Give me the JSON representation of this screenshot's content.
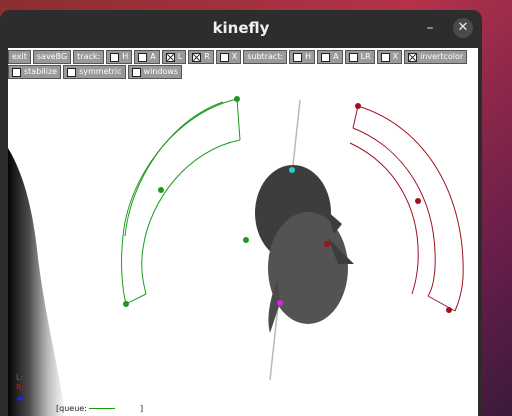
{
  "window": {
    "title": "kinefly"
  },
  "controls": {
    "minimize_glyph": "–",
    "close_glyph": "✕"
  },
  "toolbar": {
    "row1": [
      {
        "label": "exit",
        "checkbox": false
      },
      {
        "label": "saveBG",
        "checkbox": false
      },
      {
        "label": "track:",
        "checkbox": false
      },
      {
        "label": "H",
        "checkbox": true,
        "checked": false
      },
      {
        "label": "A",
        "checkbox": true,
        "checked": false
      },
      {
        "label": "L",
        "checkbox": true,
        "checked": true
      },
      {
        "label": "R",
        "checkbox": true,
        "checked": true
      },
      {
        "label": "X",
        "checkbox": true,
        "checked": false
      },
      {
        "label": "subtract:",
        "checkbox": false
      },
      {
        "label": "H",
        "checkbox": true,
        "checked": false
      },
      {
        "label": "A",
        "checkbox": true,
        "checked": false
      },
      {
        "label": "LR",
        "checkbox": true,
        "checked": false
      },
      {
        "label": "X",
        "checkbox": true,
        "checked": false
      },
      {
        "label": "invertcolor",
        "checkbox": true,
        "checked": true
      }
    ],
    "row2": [
      {
        "label": "stabilize",
        "checkbox": true,
        "checked": false
      },
      {
        "label": "symmetric",
        "checkbox": true,
        "checked": false
      },
      {
        "label": "windows",
        "checkbox": true,
        "checked": false
      }
    ]
  },
  "legend": {
    "left": "L:",
    "right": "R:",
    "queue_prefix": "[queue:",
    "queue_suffix": "]"
  },
  "colors": {
    "left_wing": "#1a9a1a",
    "right_wing": "#a01020",
    "head_point": "#22d0d0",
    "abdomen_point": "#e020e0",
    "legend_left": "#12a012",
    "legend_right": "#d01010",
    "legend_extra": "#2020ff"
  }
}
